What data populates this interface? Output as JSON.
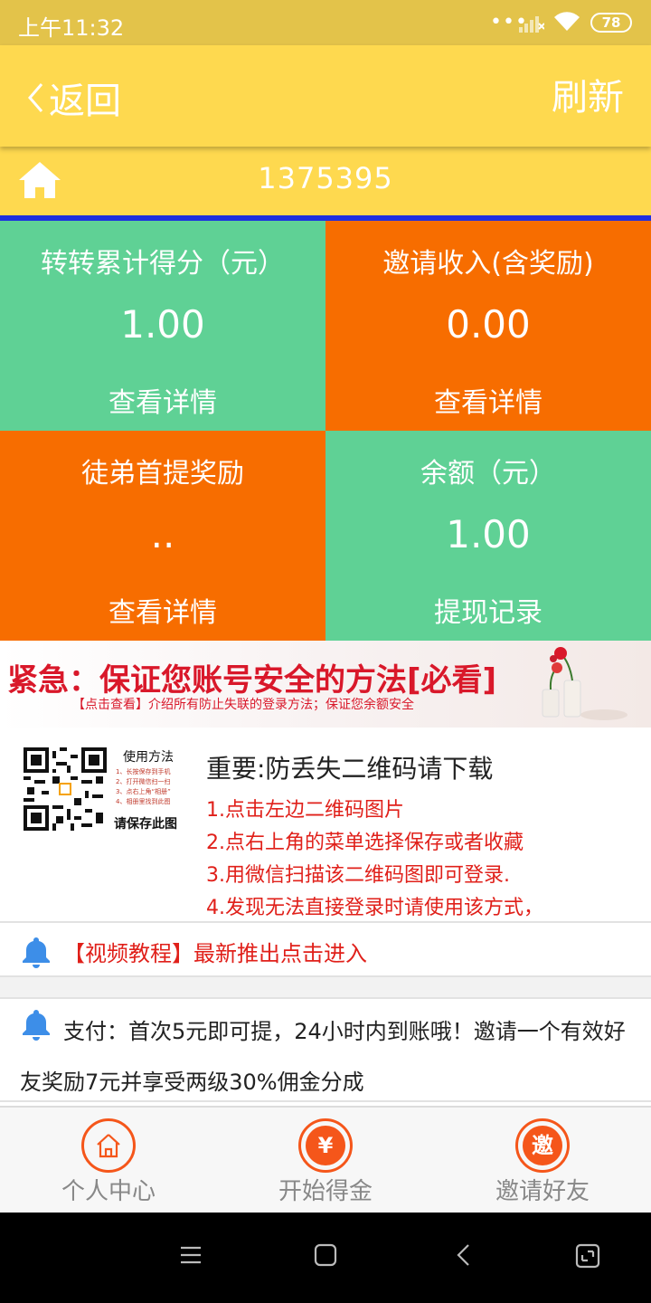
{
  "status": {
    "time": "上午11:32",
    "dots": "•••",
    "battery": "78"
  },
  "header": {
    "back_label": "返回",
    "refresh_label": "刷新"
  },
  "user": {
    "id": "1375395"
  },
  "tiles": [
    {
      "title": "转转累计得分（元）",
      "value": "1.00",
      "link": "查看详情",
      "color": "#5fd195"
    },
    {
      "title": "邀请收入(含奖励)",
      "value": "0.00",
      "link": "查看详情",
      "color": "#f76d00"
    },
    {
      "title": "徒弟首提奖励",
      "value": "..",
      "link": "查看详情",
      "color": "#f76d00"
    },
    {
      "title": "余额（元）",
      "value": "1.00",
      "link": "提现记录",
      "color": "#5fd195"
    }
  ],
  "banner": {
    "main": "紧急：保证您账号安全的方法[必看]",
    "sub": "【点击查看】介绍所有防止失联的登录方法；保证您余额安全"
  },
  "qr": {
    "how_title": "使用方法",
    "how_steps": [
      "1、长按保存到手机",
      "2、打开微信扫一扫",
      "3、点右上角“相册”",
      "4、相册里找到此图"
    ],
    "save_label": "请保存此图",
    "title": "重要:防丢失二维码请下载",
    "steps": [
      "1.点击左边二维码图片",
      "2.点右上角的菜单选择保存或者收藏",
      "3.用微信扫描该二维码图即可登录.",
      "4.发现无法直接登录时请使用该方式，"
    ]
  },
  "notices": {
    "video": "【视频教程】最新推出点击进入",
    "payment": "支付：首次5元即可提，24小时内到账哦！邀请一个有效好友奖励7元并享受两级30%佣金分成"
  },
  "tabs": [
    {
      "label": "个人中心",
      "icon": "home-icon"
    },
    {
      "label": "开始得金",
      "icon": "yuan-icon",
      "glyph": "¥"
    },
    {
      "label": "邀请好友",
      "icon": "invite-icon",
      "glyph": "邀"
    }
  ],
  "colors": {
    "yellow": "#fed94f",
    "green": "#5fd195",
    "orange": "#f76d00",
    "accent": "#f5561a",
    "red": "#e0201a"
  }
}
